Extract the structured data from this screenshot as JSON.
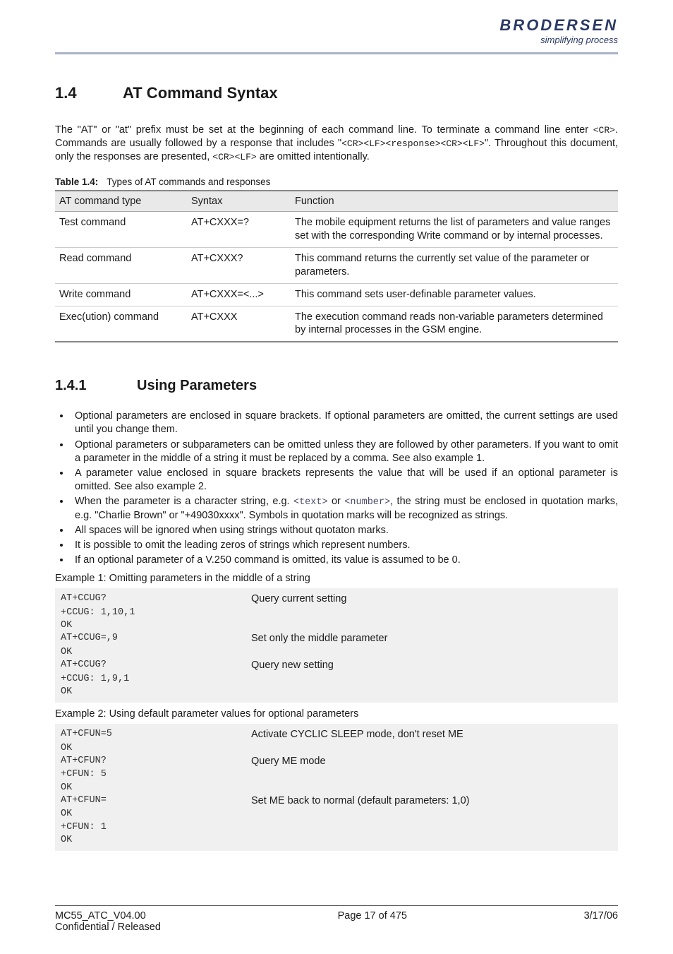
{
  "brand": {
    "name": "BRODERSEN",
    "tagline": "simplifying process"
  },
  "section_1_4": {
    "number": "1.4",
    "title": "AT Command Syntax",
    "intro_plain_1": "The \"AT\" or \"at\" prefix must be set at the beginning of each command line. To terminate a command line enter ",
    "intro_cr": "<CR>",
    "intro_plain_2": ". Commands are usually followed by a response that includes \"",
    "intro_resp": "<CR><LF><response><CR><LF>",
    "intro_plain_3": "\". Throughout this document, only the responses are presented, ",
    "intro_crlf": "<CR><LF>",
    "intro_plain_4": " are omitted intentionally."
  },
  "table_caption": {
    "label": "Table 1.4:",
    "text": "Types of AT commands and responses"
  },
  "table_headers": {
    "h1": "AT command type",
    "h2": "Syntax",
    "h3": "Function"
  },
  "table_rows": [
    {
      "type": "Test command",
      "syntax": "AT+CXXX=?",
      "func": "The mobile equipment returns the list of parameters and value ranges set with the corresponding Write command or by internal processes."
    },
    {
      "type": "Read command",
      "syntax": "AT+CXXX?",
      "func": "This command returns the currently set value of the parameter or parameters."
    },
    {
      "type": "Write command",
      "syntax": "AT+CXXX=<...>",
      "func": "This command sets user-definable parameter values."
    },
    {
      "type": "Exec(ution) command",
      "syntax": "AT+CXXX",
      "func": "The execution command reads non-variable parameters determined by internal processes in the GSM engine."
    }
  ],
  "section_1_4_1": {
    "number": "1.4.1",
    "title": "Using Parameters"
  },
  "bullets": {
    "b1": "Optional parameters are enclosed in square brackets. If optional parameters are omitted, the current settings are used until you change them.",
    "b2": "Optional parameters or subparameters can be omitted unless they are followed by other parameters. If you want to omit a parameter in the middle of a string it must be replaced by a comma. See also example 1.",
    "b3": "A parameter value enclosed in square brackets represents the value that will be used if an optional parameter is omitted. See also example 2.",
    "b4a": "When the parameter is a character string, e.g. ",
    "b4_tt1": "<text>",
    "b4b": " or ",
    "b4_tt2": "<number>",
    "b4c": ", the string must be enclosed in quotation marks, e.g. \"Charlie Brown\" or \"+49030xxxx\". Symbols in quotation marks will be recognized as strings.",
    "b5": "All spaces will be ignored when using strings without quotaton marks.",
    "b6": "It is possible to omit the leading zeros of strings which represent numbers.",
    "b7": "If an optional parameter of a V.250 command is omitted, its value is assumed to be 0."
  },
  "example1_label": "Example 1: Omitting parameters in the middle of a string",
  "example1": [
    {
      "cmd": "AT+CCUG?",
      "desc": "Query current setting"
    },
    {
      "cmd": "+CCUG: 1,10,1",
      "desc": ""
    },
    {
      "cmd": "OK",
      "desc": ""
    },
    {
      "cmd": "AT+CCUG=,9",
      "desc": "Set only the middle parameter"
    },
    {
      "cmd": "OK",
      "desc": ""
    },
    {
      "cmd": "AT+CCUG?",
      "desc": "Query new setting"
    },
    {
      "cmd": "+CCUG: 1,9,1",
      "desc": ""
    },
    {
      "cmd": "OK",
      "desc": ""
    }
  ],
  "example2_label": "Example 2: Using default parameter values for optional parameters",
  "example2": [
    {
      "cmd": "AT+CFUN=5",
      "desc": "Activate CYCLIC SLEEP mode, don't reset ME"
    },
    {
      "cmd": "OK",
      "desc": ""
    },
    {
      "cmd": "AT+CFUN?",
      "desc": "Query ME mode"
    },
    {
      "cmd": "+CFUN: 5",
      "desc": ""
    },
    {
      "cmd": "OK",
      "desc": ""
    },
    {
      "cmd": "AT+CFUN=",
      "desc": "Set ME back to normal (default parameters: 1,0)"
    },
    {
      "cmd": "OK",
      "desc": ""
    },
    {
      "cmd": "+CFUN: 1",
      "desc": ""
    },
    {
      "cmd": "OK",
      "desc": ""
    }
  ],
  "footer": {
    "doc_id": "MC55_ATC_V04.00",
    "confidential": "Confidential / Released",
    "page": "Page 17 of 475",
    "date": "3/17/06"
  }
}
